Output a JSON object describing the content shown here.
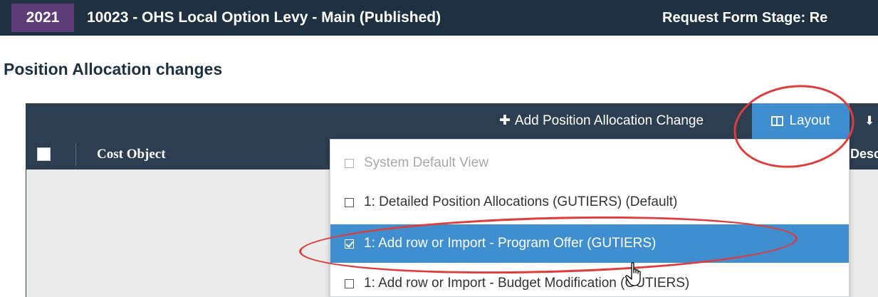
{
  "header": {
    "year": "2021",
    "project_title": "10023 - OHS Local Option Levy - Main (Published)",
    "stage_text": "Request Form Stage: Re"
  },
  "section": {
    "title": "Position Allocation changes"
  },
  "toolbar": {
    "add_label": "Add Position Allocation Change",
    "add_icon": "plus-icon",
    "layout_label": "Layout",
    "layout_icon": "columns-icon",
    "download_icon": "download-icon"
  },
  "grid": {
    "columns": [
      "Cost Object",
      "Descri"
    ]
  },
  "layout_menu": {
    "items": [
      {
        "label": "System Default View",
        "state": "disabled",
        "checked": false
      },
      {
        "label": "1: Detailed Position Allocations (GUTIERS) (Default)",
        "state": "normal",
        "checked": false
      },
      {
        "label": "1: Add row or Import - Program Offer (GUTIERS)",
        "state": "selected",
        "checked": true
      },
      {
        "label": "1: Add row or Import - Budget Modification (GUTIERS)",
        "state": "normal",
        "checked": false
      }
    ]
  },
  "colors": {
    "header_bg": "#1f3140",
    "year_bg": "#5c3d77",
    "toolbar_bg": "#2c3e50",
    "accent_blue": "#3e8ed0",
    "annotation_red": "#e03c3c"
  }
}
